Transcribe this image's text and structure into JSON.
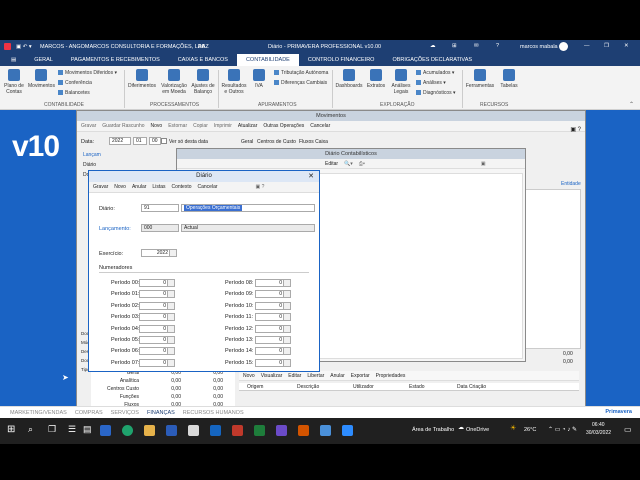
{
  "titlebar": {
    "company": "MARCOS - ANGOMARCOS CONSULTORIA E FORMAÇÕES, LDA.",
    "year": "ABZ",
    "title": "Diário - PRIMAVERA PROFESSIONAL v10.00",
    "user": "marcos mabala"
  },
  "tabs": [
    "GERAL",
    "PAGAMENTOS E RECEBIMENTOS",
    "CAIXAS E BANCOS",
    "CONTABILIDADE",
    "CONTROLO FINANCEIRO",
    "OBRIGAÇÕES DECLARATIVAS"
  ],
  "ribbon": {
    "buttons": [
      {
        "label": "Plano de Contas"
      },
      {
        "label": "Movimentos"
      },
      {
        "label": "Diferimentos"
      },
      {
        "label": "Valorização em Moeda"
      },
      {
        "label": "Ajustes de Balanço"
      },
      {
        "label": "IVA"
      },
      {
        "label": "Resultados e Outros"
      },
      {
        "label": "Dashboards"
      },
      {
        "label": "Extratos"
      },
      {
        "label": "Análises Legais"
      },
      {
        "label": "Ferramentas"
      },
      {
        "label": "Tabelas"
      }
    ],
    "small_items": [
      "Movimentos Diferidos",
      "Conferência",
      "Balancetes",
      "Tributação Autónoma",
      "Diferenças Cambiais",
      "Acumulados",
      "Análises",
      "Diagnósticos"
    ],
    "groups": [
      "CONTABILIDADE",
      "PROCESSAMENTOS",
      "APURAMENTOS",
      "EXPLORAÇÃO",
      "RECURSOS"
    ]
  },
  "movimentos": {
    "title": "Movimentos",
    "toolbar": [
      "Gravar",
      "Guardar Rascunho",
      "Novo",
      "Estornar",
      "Copiar",
      "Imprimir",
      "Atualizar",
      "Outras Operações",
      "Cancelar"
    ],
    "data_label": "Data:",
    "date_value": "2022",
    "month_value": "01",
    "day_value": "00",
    "checkbox_label": "Ver só desta data",
    "tabs": [
      "Geral",
      "Centros de Custo",
      "Fluxos Caixa"
    ],
    "side_labels": [
      "Lançam",
      "Diário",
      "Doc"
    ],
    "grid_header": "Entidade",
    "bottom_rows": [
      {
        "label": "Geral",
        "v1": "0,00",
        "v2": "0,00"
      },
      {
        "label": "Analítica",
        "v1": "0,00",
        "v2": "0,00"
      },
      {
        "label": "Centros Custo",
        "v1": "0,00",
        "v2": "0,00"
      },
      {
        "label": "Funções",
        "v1": "0,00",
        "v2": "0,00"
      },
      {
        "label": "Fluxos",
        "v1": "0,00",
        "v2": "0,00"
      }
    ],
    "right_values": [
      "0,00",
      "0,00"
    ],
    "bottom_toolbar": [
      "Novo",
      "Visualizar",
      "Editar",
      "Libertar",
      "Anular",
      "Exportar",
      "Propriedades"
    ],
    "bottom_grid_headers": [
      "Origem",
      "Descrição",
      "Utilizador",
      "Estado",
      "Data Criação"
    ],
    "side_rows": [
      "Doc",
      "Mód",
      "Desc",
      "Doc",
      "Tipo"
    ]
  },
  "doc_contab": {
    "title": "Diário Contabilísticos",
    "toolbar": [
      "Editar"
    ]
  },
  "diario": {
    "title": "Diário",
    "toolbar": [
      "Gravar",
      "Novo",
      "Anular",
      "Listas",
      "Contexto",
      "Cancelar"
    ],
    "diario_label": "Diário:",
    "diario_code": "91",
    "diario_desc": "Operações Orçamentais",
    "lanc_label": "Lançamento:",
    "lanc_code": "000",
    "lanc_desc": "Actual",
    "exercicio_label": "Exercício:",
    "exercicio_value": "2022",
    "numeradores_label": "Numeradores",
    "periodos_left": [
      {
        "label": "Período 00:",
        "value": "0"
      },
      {
        "label": "Período 01:",
        "value": "0"
      },
      {
        "label": "Período 02:",
        "value": "0"
      },
      {
        "label": "Período 03:",
        "value": "0"
      },
      {
        "label": "Período 04:",
        "value": "0"
      },
      {
        "label": "Período 05:",
        "value": "0"
      },
      {
        "label": "Período 06:",
        "value": "0"
      },
      {
        "label": "Período 07:",
        "value": "0"
      }
    ],
    "periodos_right": [
      {
        "label": "Período 08:",
        "value": "0"
      },
      {
        "label": "Período 09:",
        "value": "0"
      },
      {
        "label": "Período 10:",
        "value": "0"
      },
      {
        "label": "Período 11:",
        "value": "0"
      },
      {
        "label": "Período 12:",
        "value": "0"
      },
      {
        "label": "Período 13:",
        "value": "0"
      },
      {
        "label": "Período 14:",
        "value": "0"
      },
      {
        "label": "Período 15:",
        "value": "0"
      }
    ]
  },
  "bottomnav": {
    "items": [
      "MARKETING/VENDAS",
      "COMPRAS",
      "SERVIÇOS",
      "FINANÇAS",
      "RECURSOS HUMANOS"
    ],
    "active_index": 3,
    "logo": "Primavera"
  },
  "taskbar": {
    "desktop_label": "Área de Trabalho",
    "onedrive": "OneDrive",
    "temperature": "26°C",
    "time": "06:40",
    "date": "30/03/2022"
  },
  "splash": {
    "text": "v10"
  },
  "colors": {
    "brand_dark": "#1e3f73",
    "workspace": "#1a63c4",
    "selection": "#3a6fd1"
  }
}
